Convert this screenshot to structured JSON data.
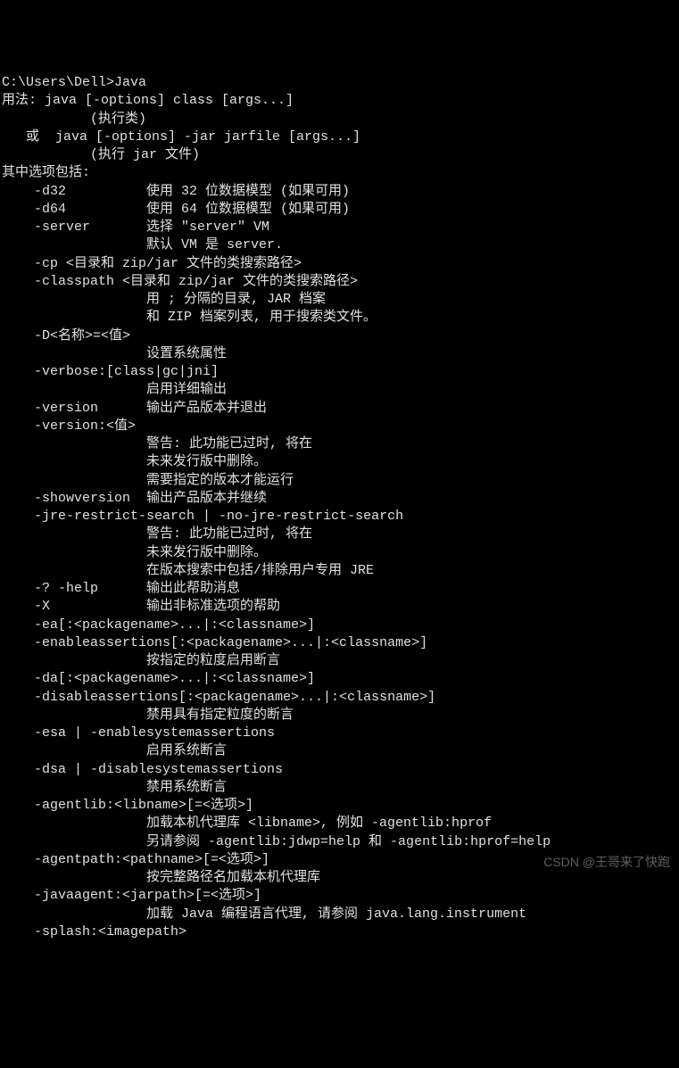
{
  "terminal": {
    "lines": [
      "C:\\Users\\Dell>Java",
      "用法: java [-options] class [args...]",
      "           (执行类)",
      "   或  java [-options] -jar jarfile [args...]",
      "           (执行 jar 文件)",
      "其中选项包括:",
      "    -d32          使用 32 位数据模型 (如果可用)",
      "    -d64          使用 64 位数据模型 (如果可用)",
      "    -server       选择 \"server\" VM",
      "                  默认 VM 是 server.",
      "",
      "    -cp <目录和 zip/jar 文件的类搜索路径>",
      "    -classpath <目录和 zip/jar 文件的类搜索路径>",
      "                  用 ; 分隔的目录, JAR 档案",
      "                  和 ZIP 档案列表, 用于搜索类文件。",
      "    -D<名称>=<值>",
      "                  设置系统属性",
      "    -verbose:[class|gc|jni]",
      "                  启用详细输出",
      "    -version      输出产品版本并退出",
      "    -version:<值>",
      "                  警告: 此功能已过时, 将在",
      "                  未来发行版中删除。",
      "                  需要指定的版本才能运行",
      "    -showversion  输出产品版本并继续",
      "    -jre-restrict-search | -no-jre-restrict-search",
      "                  警告: 此功能已过时, 将在",
      "                  未来发行版中删除。",
      "                  在版本搜索中包括/排除用户专用 JRE",
      "    -? -help      输出此帮助消息",
      "    -X            输出非标准选项的帮助",
      "    -ea[:<packagename>...|:<classname>]",
      "    -enableassertions[:<packagename>...|:<classname>]",
      "                  按指定的粒度启用断言",
      "    -da[:<packagename>...|:<classname>]",
      "    -disableassertions[:<packagename>...|:<classname>]",
      "                  禁用具有指定粒度的断言",
      "    -esa | -enablesystemassertions",
      "                  启用系统断言",
      "    -dsa | -disablesystemassertions",
      "                  禁用系统断言",
      "    -agentlib:<libname>[=<选项>]",
      "                  加载本机代理库 <libname>, 例如 -agentlib:hprof",
      "                  另请参阅 -agentlib:jdwp=help 和 -agentlib:hprof=help",
      "    -agentpath:<pathname>[=<选项>]",
      "                  按完整路径名加载本机代理库",
      "    -javaagent:<jarpath>[=<选项>]",
      "                  加载 Java 编程语言代理, 请参阅 java.lang.instrument",
      "    -splash:<imagepath>"
    ]
  },
  "watermark": "CSDN @王哥来了快跑"
}
